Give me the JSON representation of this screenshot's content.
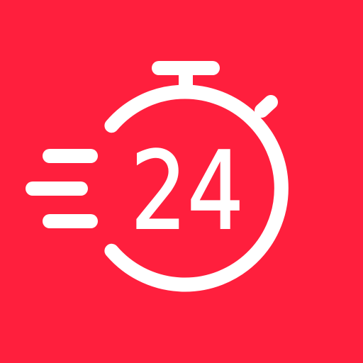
{
  "icon": {
    "number": "24",
    "glyph": "stopwatch-icon",
    "background_color": "#FF1F3D",
    "foreground_color": "#FFFFFF"
  }
}
